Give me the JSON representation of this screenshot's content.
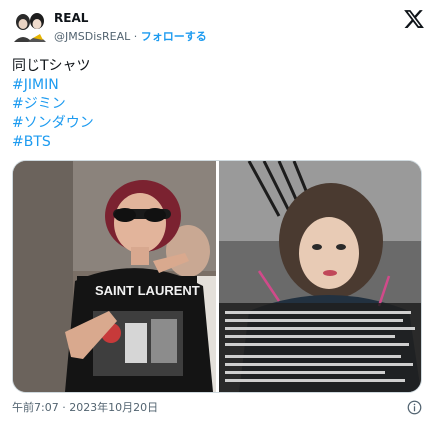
{
  "user": {
    "display_name": "REAL",
    "handle": "@JMSDisREAL",
    "separator": " · ",
    "follow_label": "フォローする"
  },
  "icons": {
    "avatar": "avatar-image",
    "logo": "x-logo-icon",
    "info": "info-icon"
  },
  "tweet": {
    "line1": "同じTシャツ",
    "hashtags": [
      "#JIMIN",
      "#ジミン",
      "#ソンダウン",
      "#BTS"
    ]
  },
  "footer": {
    "timestamp": "午前7:07 · 2023年10月20日"
  },
  "colors": {
    "accent": "#1d9bf0",
    "secondary_text": "#536471",
    "primary_text": "#0f1419"
  }
}
